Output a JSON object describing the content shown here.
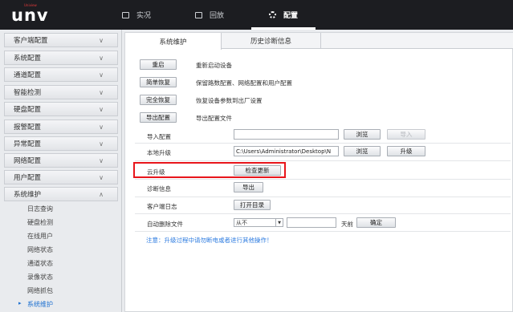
{
  "logo": {
    "text": "unv",
    "tag": "Uniview"
  },
  "nav": [
    {
      "label": "实况",
      "icon": "monitor-icon"
    },
    {
      "label": "回放",
      "icon": "film-icon"
    },
    {
      "label": "配置",
      "icon": "gear-icon"
    }
  ],
  "sidebar": {
    "groups": [
      {
        "label": "客户端配置",
        "icon": "chevron-down-icon"
      },
      {
        "label": "系统配置",
        "icon": "chevron-down-icon"
      },
      {
        "label": "通道配置",
        "icon": "chevron-down-icon"
      },
      {
        "label": "智能检测",
        "icon": "chevron-down-icon"
      },
      {
        "label": "硬盘配置",
        "icon": "chevron-down-icon"
      },
      {
        "label": "报警配置",
        "icon": "chevron-down-icon"
      },
      {
        "label": "异常配置",
        "icon": "chevron-down-icon"
      },
      {
        "label": "网络配置",
        "icon": "chevron-down-icon"
      },
      {
        "label": "用户配置",
        "icon": "chevron-down-icon"
      },
      {
        "label": "系统维护",
        "icon": "chevron-up-icon"
      }
    ],
    "subitems": [
      "日志查询",
      "硬盘检测",
      "在线用户",
      "网络状态",
      "通道状态",
      "录像状态",
      "网络抓包",
      "系统维护"
    ]
  },
  "tabs": [
    "系统维护",
    "历史诊断信息"
  ],
  "actions": [
    {
      "button": "重启",
      "desc": "重新启动设备"
    },
    {
      "button": "简单恢复",
      "desc": "保留路数配置、网络配置和用户配置"
    },
    {
      "button": "完全恢复",
      "desc": "恢复设备参数到出厂设置"
    },
    {
      "button": "导出配置",
      "desc": "导出配置文件"
    }
  ],
  "import_config": {
    "label": "导入配置",
    "value": "",
    "browse": "浏览",
    "import": "导入"
  },
  "local_upgrade": {
    "label": "本地升级",
    "value": "C:\\Users\\Administrator\\Desktop\\N",
    "browse": "浏览",
    "upgrade": "升级"
  },
  "cloud_upgrade": {
    "label": "云升级",
    "button": "检查更新"
  },
  "diagnostics": {
    "label": "诊断信息",
    "button": "导出"
  },
  "client_log": {
    "label": "客户端日志",
    "button": "打开目录"
  },
  "auto_delete": {
    "label": "自动删除文件",
    "select": "从不",
    "days_value": "",
    "days_unit": "天前",
    "confirm": "确定"
  },
  "notice": "注意：升级过程中请勿断电或者进行其他操作！"
}
